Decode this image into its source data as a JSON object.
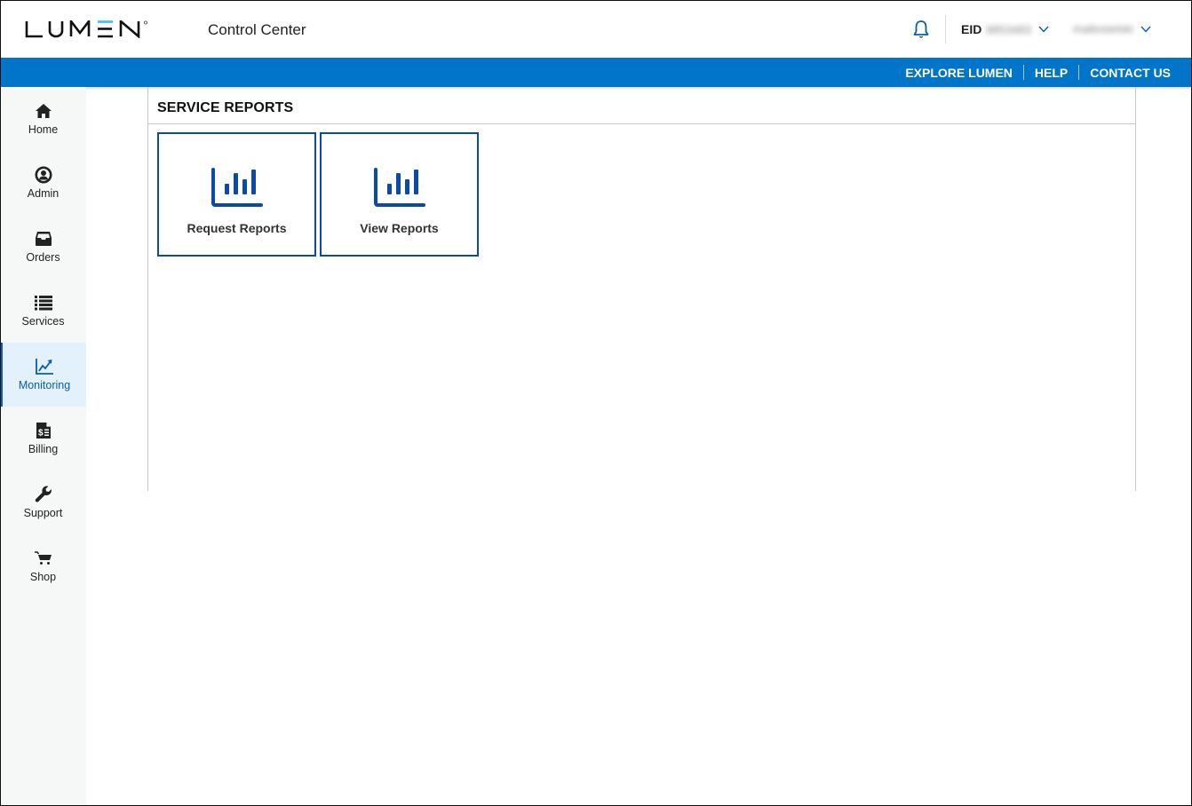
{
  "header": {
    "brand": "LUMEN",
    "app_title": "Control Center",
    "eid_label": "EID",
    "eid_value": "8853483",
    "user_name": "mattosielski",
    "notifications_icon": "bell-icon"
  },
  "top_links": [
    {
      "label": "EXPLORE LUMEN"
    },
    {
      "label": "HELP"
    },
    {
      "label": "CONTACT US"
    }
  ],
  "sidebar": {
    "active": "Monitoring",
    "items": [
      {
        "label": "Home",
        "icon": "home-icon"
      },
      {
        "label": "Admin",
        "icon": "user-circle-icon"
      },
      {
        "label": "Orders",
        "icon": "inbox-icon"
      },
      {
        "label": "Services",
        "icon": "list-icon"
      },
      {
        "label": "Monitoring",
        "icon": "chart-line-icon"
      },
      {
        "label": "Billing",
        "icon": "invoice-dollar-icon"
      },
      {
        "label": "Support",
        "icon": "wrench-icon"
      },
      {
        "label": "Shop",
        "icon": "cart-icon"
      }
    ]
  },
  "main": {
    "section_title": "SERVICE REPORTS",
    "tiles": [
      {
        "label": "Request Reports",
        "icon": "bar-chart-icon"
      },
      {
        "label": "View Reports",
        "icon": "bar-chart-icon"
      }
    ]
  },
  "colors": {
    "brand_blue": "#0075c9",
    "tile_border": "#0b4aa8",
    "active_nav_bg": "#e3f1fd",
    "active_nav_text": "#0b5cad",
    "logo_accent": "#38c6f4"
  }
}
